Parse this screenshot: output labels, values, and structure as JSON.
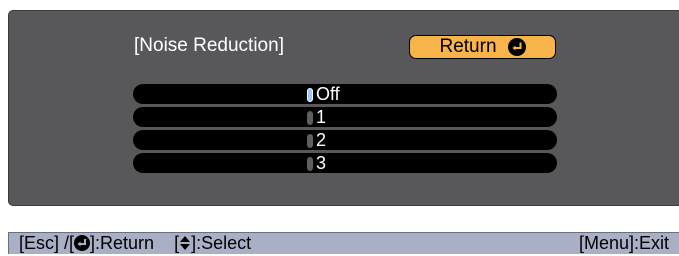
{
  "menu": {
    "title": "[Noise Reduction]",
    "return_label": "Return",
    "return_icon": "enter-icon",
    "options": [
      {
        "label": "Off",
        "selected": true
      },
      {
        "label": "1",
        "selected": false
      },
      {
        "label": "2",
        "selected": false
      },
      {
        "label": "3",
        "selected": false
      }
    ]
  },
  "status_bar": {
    "esc_text": "[Esc] /[",
    "return_text": "]:Return",
    "select_open": "[",
    "select_text": "]:Select",
    "exit_text": "[Menu]:Exit",
    "enter_icon": "enter-icon",
    "select_icon": "up-down-arrow-icon"
  },
  "colors": {
    "panel_bg": "#58585a",
    "button_bg": "#f6b44a",
    "option_bg": "#000000",
    "selected_radio": "#9fc6ff",
    "status_bar_bg": "#a9b0c6"
  }
}
